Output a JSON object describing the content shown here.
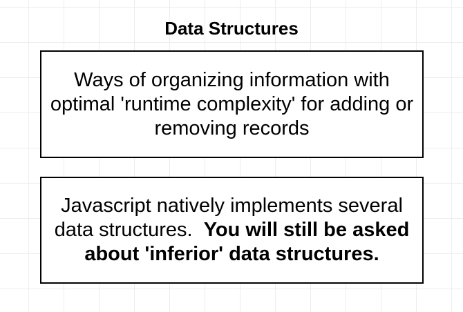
{
  "title": "Data Structures",
  "boxes": [
    {
      "text": "Ways of organizing information with optimal 'runtime complexity' for adding or removing records"
    },
    {
      "text": "Javascript natively implements several data structures.",
      "bold_text": "You will still be asked about 'inferior' data structures."
    }
  ]
}
